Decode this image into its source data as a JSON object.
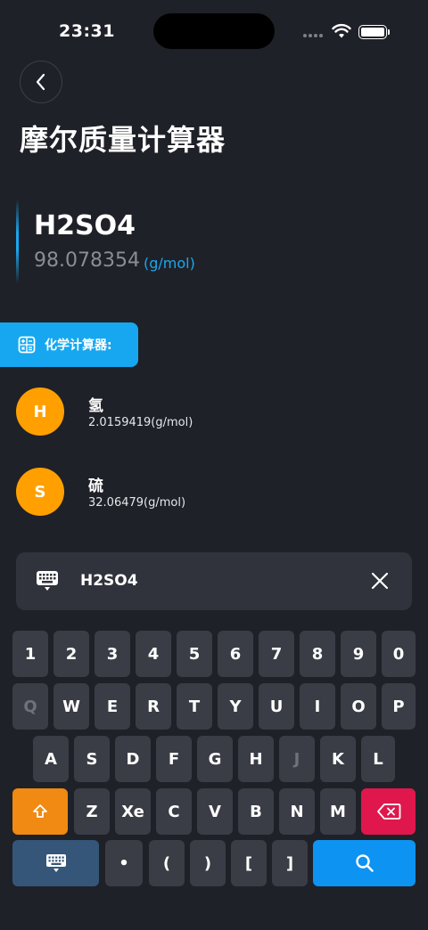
{
  "status_bar": {
    "time": "23:31"
  },
  "header": {
    "title": "摩尔质量计算器"
  },
  "result": {
    "formula": "H2SO4",
    "molar_mass": "98.078354",
    "unit": "(g/mol)"
  },
  "calculator_tag": {
    "label": "化学计算器:"
  },
  "elements": [
    {
      "symbol": "H",
      "name": "氢",
      "mass": "2.0159419(g/mol)"
    },
    {
      "symbol": "S",
      "name": "硫",
      "mass": "32.06479(g/mol)"
    }
  ],
  "input": {
    "value": "H2SO4"
  },
  "keyboard": {
    "row1": [
      "1",
      "2",
      "3",
      "4",
      "5",
      "6",
      "7",
      "8",
      "9",
      "0"
    ],
    "row2": [
      "Q",
      "W",
      "E",
      "R",
      "T",
      "Y",
      "U",
      "I",
      "O",
      "P"
    ],
    "row3": [
      "A",
      "S",
      "D",
      "F",
      "G",
      "H",
      "J",
      "K",
      "L"
    ],
    "row4": [
      "Z",
      "Xe",
      "C",
      "V",
      "B",
      "N",
      "M"
    ],
    "row5": [
      "•",
      "(",
      ")",
      "[",
      "]"
    ]
  },
  "colors": {
    "accent": "#1aa7ee",
    "element_badge": "#ffa000",
    "shift": "#f08a12",
    "delete": "#e0174c",
    "search": "#0d93f2"
  }
}
